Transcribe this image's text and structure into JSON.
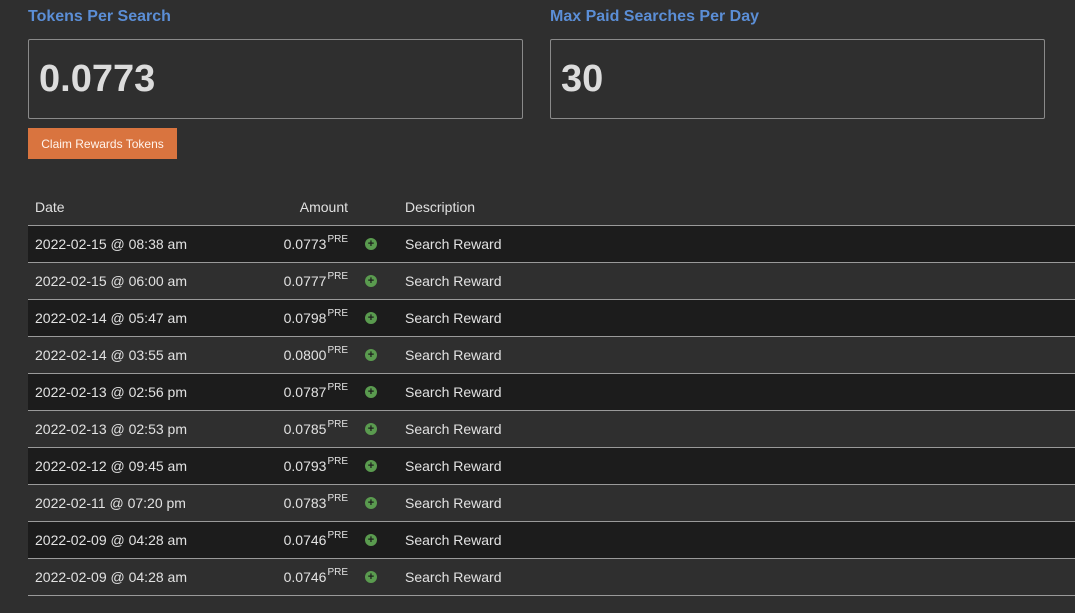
{
  "stats": {
    "tokens_per_search": {
      "label": "Tokens Per Search",
      "value": "0.0773"
    },
    "max_paid_searches": {
      "label": "Max Paid Searches Per Day",
      "value": "30"
    }
  },
  "claim_button": {
    "label": "Claim Rewards Tokens",
    "color": "#d9743f"
  },
  "table": {
    "headers": {
      "date": "Date",
      "amount": "Amount",
      "description": "Description"
    },
    "unit": "PRE",
    "rows": [
      {
        "date": "2022-02-15 @ 08:38 am",
        "amount": "0.0773",
        "unit": "PRE",
        "icon": "plus-circle-icon",
        "description": "Search Reward"
      },
      {
        "date": "2022-02-15 @ 06:00 am",
        "amount": "0.0777",
        "unit": "PRE",
        "icon": "plus-circle-icon",
        "description": "Search Reward"
      },
      {
        "date": "2022-02-14 @ 05:47 am",
        "amount": "0.0798",
        "unit": "PRE",
        "icon": "plus-circle-icon",
        "description": "Search Reward"
      },
      {
        "date": "2022-02-14 @ 03:55 am",
        "amount": "0.0800",
        "unit": "PRE",
        "icon": "plus-circle-icon",
        "description": "Search Reward"
      },
      {
        "date": "2022-02-13 @ 02:56 pm",
        "amount": "0.0787",
        "unit": "PRE",
        "icon": "plus-circle-icon",
        "description": "Search Reward"
      },
      {
        "date": "2022-02-13 @ 02:53 pm",
        "amount": "0.0785",
        "unit": "PRE",
        "icon": "plus-circle-icon",
        "description": "Search Reward"
      },
      {
        "date": "2022-02-12 @ 09:45 am",
        "amount": "0.0793",
        "unit": "PRE",
        "icon": "plus-circle-icon",
        "description": "Search Reward"
      },
      {
        "date": "2022-02-11 @ 07:20 pm",
        "amount": "0.0783",
        "unit": "PRE",
        "icon": "plus-circle-icon",
        "description": "Search Reward"
      },
      {
        "date": "2022-02-09 @ 04:28 am",
        "amount": "0.0746",
        "unit": "PRE",
        "icon": "plus-circle-icon",
        "description": "Search Reward"
      },
      {
        "date": "2022-02-09 @ 04:28 am",
        "amount": "0.0746",
        "unit": "PRE",
        "icon": "plus-circle-icon",
        "description": "Search Reward"
      }
    ]
  },
  "colors": {
    "label_blue": "#5b8ed6",
    "positive_green": "#5a9b4f",
    "background": "#2f2f2f",
    "row_dark": "#1c1c1c"
  }
}
